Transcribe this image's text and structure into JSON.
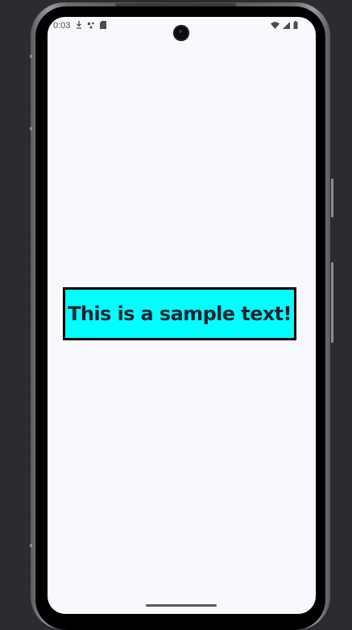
{
  "status_bar": {
    "time": "0:03",
    "left_icons": [
      "download-icon",
      "assistant-icon",
      "sd-card-icon"
    ],
    "right_icons": [
      "wifi-icon",
      "signal-icon",
      "battery-icon"
    ]
  },
  "main": {
    "sample_text": "This is a sample text!",
    "box_color": "#00ffff",
    "border_color": "#000000",
    "background_color": "#f8f8ff"
  }
}
